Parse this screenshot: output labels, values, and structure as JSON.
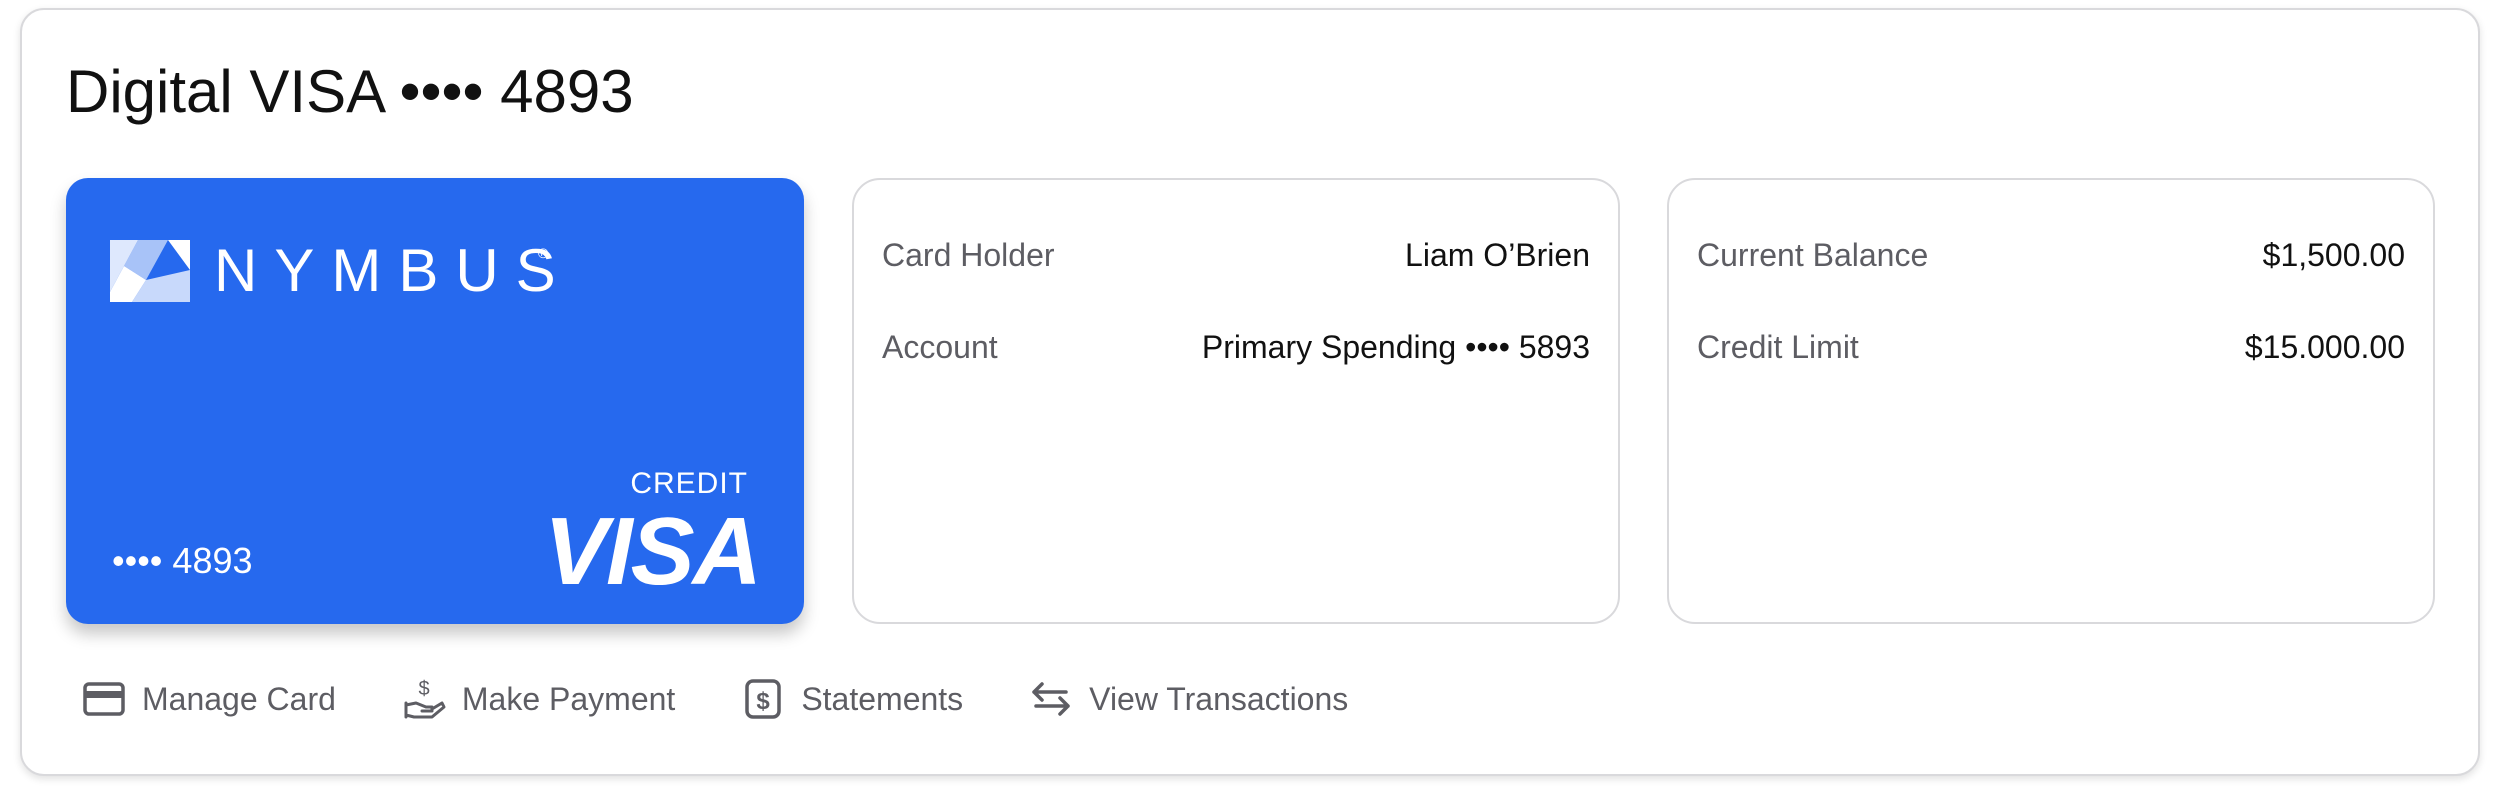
{
  "title": "Digital VISA •••• 4893",
  "card": {
    "brand": "NYMBUS",
    "registered_mark": "®",
    "masked_number": "•••• 4893",
    "type_label": "CREDIT",
    "network": "VISA",
    "color": "#2669ee"
  },
  "account_details": {
    "card_holder_label": "Card Holder",
    "card_holder_value": "Liam O’Brien",
    "account_label": "Account",
    "account_value": "Primary Spending •••• 5893"
  },
  "balance_details": {
    "current_balance_label": "Current Balance",
    "current_balance_value": "$1,500.00",
    "credit_limit_label": "Credit Limit",
    "credit_limit_value": "$15.000.00"
  },
  "actions": [
    {
      "label": "Manage Card",
      "icon": "credit-card-icon"
    },
    {
      "label": "Make Payment",
      "icon": "hand-dollar-icon"
    },
    {
      "label": "Statements",
      "icon": "dollar-document-icon"
    },
    {
      "label": "View Transactions",
      "icon": "swap-arrows-icon"
    }
  ]
}
